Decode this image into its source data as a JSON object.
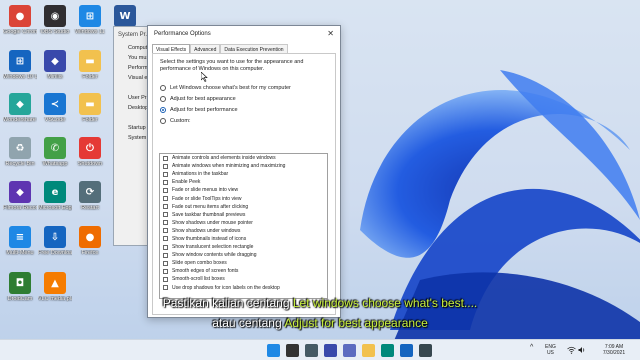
{
  "desktop": {
    "icons": [
      {
        "label": "Google Chrome",
        "color": "#db4437",
        "glyph": "●"
      },
      {
        "label": "OBS Studio",
        "color": "#302e31",
        "glyph": "◉"
      },
      {
        "label": "Windows 11",
        "color": "#1e88e5",
        "glyph": "⊞"
      },
      {
        "label": "",
        "color": "#2b579a",
        "glyph": "W"
      },
      {
        "label": "Windows 10 Update As...",
        "color": "#1565c0",
        "glyph": "⊞"
      },
      {
        "label": "Mirillis",
        "color": "#3949ab",
        "glyph": "◆"
      },
      {
        "label": "Folder",
        "color": "#f2c14e",
        "glyph": "▬"
      },
      {
        "label": "Folder",
        "color": "#f2c14e",
        "glyph": "▬"
      },
      {
        "label": "Wondershare Filmora",
        "color": "#26a69a",
        "glyph": "◆"
      },
      {
        "label": "VSCode",
        "color": "#1976d2",
        "glyph": "≺"
      },
      {
        "label": "Folder",
        "color": "#f2c14e",
        "glyph": "▬"
      },
      {
        "label": "Folder",
        "color": "#f2c14e",
        "glyph": "▬"
      },
      {
        "label": "Recycle Bin",
        "color": "#90a4ae",
        "glyph": "♻"
      },
      {
        "label": "Whatsapp",
        "color": "#43a047",
        "glyph": "✆"
      },
      {
        "label": "Shutdown",
        "color": "#e53935",
        "glyph": "⏻"
      },
      {
        "label": "",
        "color": "transparent",
        "glyph": ""
      },
      {
        "label": "Filmora Recorder",
        "color": "#5e35b1",
        "glyph": "◆"
      },
      {
        "label": "Microsoft Edge",
        "color": "#00897b",
        "glyph": "e"
      },
      {
        "label": "Restart",
        "color": "#546e7a",
        "glyph": "⟳"
      },
      {
        "label": "",
        "color": "transparent",
        "glyph": ""
      },
      {
        "label": "Multi-Menu",
        "color": "#1e88e5",
        "glyph": "≡"
      },
      {
        "label": "Free Downloader",
        "color": "#1565c0",
        "glyph": "⇩"
      },
      {
        "label": "Firefox",
        "color": "#ef6c00",
        "glyph": "●"
      },
      {
        "label": "",
        "color": "transparent",
        "glyph": ""
      },
      {
        "label": "DroidCam",
        "color": "#2e7d32",
        "glyph": "◘"
      },
      {
        "label": "VLC media player",
        "color": "#f57c00",
        "glyph": "▲"
      }
    ]
  },
  "system_properties": {
    "title": "System Pr...",
    "rows": [
      "Computer N",
      "You mus",
      "Performance",
      "Visual e",
      "",
      "User Pr",
      "Desktop",
      "",
      "Startup",
      "System"
    ]
  },
  "dialog": {
    "title": "Performance Options",
    "close": "✕",
    "tabs": [
      "Visual Effects",
      "Advanced",
      "Data Execution Prevention"
    ],
    "intro": "Select the settings you want to use for the appearance and performance of Windows on this computer.",
    "options": [
      {
        "label": "Let Windows choose what's best for my computer",
        "selected": false
      },
      {
        "label": "Adjust for best appearance",
        "selected": false
      },
      {
        "label": "Adjust for best performance",
        "selected": true
      },
      {
        "label": "Custom:",
        "selected": false
      }
    ],
    "effects": [
      "Animate controls and elements inside windows",
      "Animate windows when minimizing and maximizing",
      "Animations in the taskbar",
      "Enable Peek",
      "Fade or slide menus into view",
      "Fade or slide ToolTips into view",
      "Fade out menu items after clicking",
      "Save taskbar thumbnail previews",
      "Show shadows under mouse pointer",
      "Show shadows under windows",
      "Show thumbnails instead of icons",
      "Show translucent selection rectangle",
      "Show window contents while dragging",
      "Slide open combo boxes",
      "Smooth edges of screen fonts",
      "Smooth-scroll list boxes",
      "Use drop shadows for icon labels on the desktop"
    ]
  },
  "subtitles": {
    "line1_pre": "Pastikan kalian centang ",
    "line1_hl": "Let windows choose what's best....",
    "line2_pre": "atau centang ",
    "line2_hl": "Adjust for best appearance"
  },
  "taskbar": {
    "apps": [
      {
        "name": "start",
        "color": "#1e88e5"
      },
      {
        "name": "search",
        "color": "#333333"
      },
      {
        "name": "task-view",
        "color": "#455a64"
      },
      {
        "name": "widgets",
        "color": "#3949ab"
      },
      {
        "name": "chat",
        "color": "#5c6bc0"
      },
      {
        "name": "file-explorer",
        "color": "#f2c14e"
      },
      {
        "name": "edge",
        "color": "#00897b"
      },
      {
        "name": "store",
        "color": "#1565c0"
      },
      {
        "name": "system-settings",
        "color": "#37474f"
      }
    ],
    "chevron": "^",
    "language": [
      "ENG",
      "US"
    ],
    "time": "7:09 AM",
    "date": "7/30/2021"
  }
}
